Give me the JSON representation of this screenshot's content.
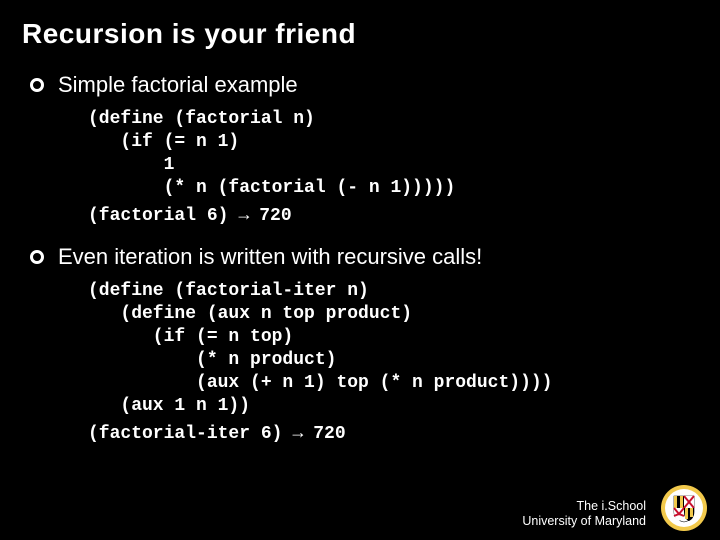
{
  "title": "Recursion is your friend",
  "bullets": [
    {
      "text": "Simple factorial example"
    },
    {
      "text": "Even iteration is written with recursive calls!"
    }
  ],
  "code1": "(define (factorial n)\n   (if (= n 1)\n       1\n       (* n (factorial (- n 1)))))",
  "result1_call": "(factorial 6)",
  "result1_arrow": "→",
  "result1_value": "720",
  "code2": "(define (factorial-iter n)\n   (define (aux n top product)\n      (if (= n top)\n          (* n product)\n          (aux (+ n 1) top (* n product))))\n   (aux 1 n 1))",
  "result2_call": "(factorial-iter 6)",
  "result2_arrow": "→",
  "result2_value": "720",
  "footer_line1": "The i.School",
  "footer_line2": "University of Maryland",
  "seal": {
    "outer": "#000000",
    "ring": "#f2c94c",
    "white": "#ffffff",
    "red": "#c8102e",
    "black": "#000000"
  }
}
